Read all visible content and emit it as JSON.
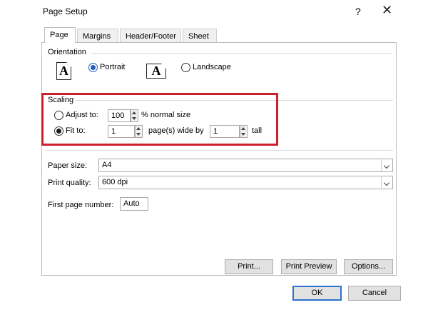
{
  "dialog": {
    "title": "Page Setup",
    "help_glyph": "?",
    "close_glyph": "✕"
  },
  "tabs": [
    {
      "label": "Page",
      "active": true
    },
    {
      "label": "Margins",
      "active": false
    },
    {
      "label": "Header/Footer",
      "active": false
    },
    {
      "label": "Sheet",
      "active": false
    }
  ],
  "orientation": {
    "label": "Orientation",
    "icon_glyph": "A",
    "portrait_label": "Portrait",
    "landscape_label": "Landscape",
    "selected": "portrait"
  },
  "scaling": {
    "label": "Scaling",
    "adjust_label": "Adjust to:",
    "adjust_value": "100",
    "adjust_suffix": "% normal size",
    "fit_label": "Fit to:",
    "fit_wide_value": "1",
    "fit_wide_suffix": "page(s) wide by",
    "fit_tall_value": "1",
    "fit_tall_suffix": "tall",
    "selected": "fit"
  },
  "paper": {
    "paper_size_label": "Paper size:",
    "paper_size_value": "A4",
    "print_quality_label": "Print quality:",
    "print_quality_value": "600 dpi",
    "first_page_label": "First page number:",
    "first_page_value": "Auto"
  },
  "buttons": {
    "print": "Print...",
    "print_preview": "Print Preview",
    "options": "Options...",
    "ok": "OK",
    "cancel": "Cancel"
  },
  "colors": {
    "highlight_border": "#cf1f2a",
    "ok_border": "#2f6fcf"
  }
}
